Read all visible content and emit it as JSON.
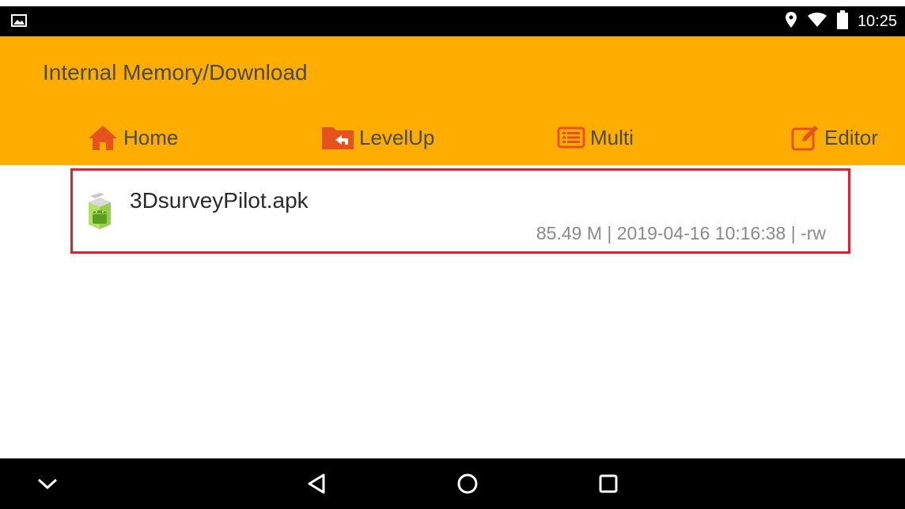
{
  "status_bar": {
    "time": "10:25",
    "icons": [
      "image-notification-icon",
      "location-icon",
      "wifi-icon",
      "battery-icon"
    ]
  },
  "header": {
    "path": "Internal Memory/Download",
    "background_color": "#FFAD00",
    "toolbar": {
      "home_label": "Home",
      "levelup_label": "LevelUp",
      "multi_label": "Multi",
      "editor_label": "Editor"
    }
  },
  "files": [
    {
      "name": "3DsurveyPilot.apk",
      "meta": "85.49 M | 2019-04-16 10:16:38 | -rw",
      "icon": "android-apk-icon",
      "highlighted": true,
      "highlight_color": "#E31E2E"
    }
  ],
  "nav_bar": {
    "icons": [
      "chevron-down-icon",
      "back-triangle-icon",
      "home-circle-icon",
      "recents-square-icon"
    ]
  }
}
